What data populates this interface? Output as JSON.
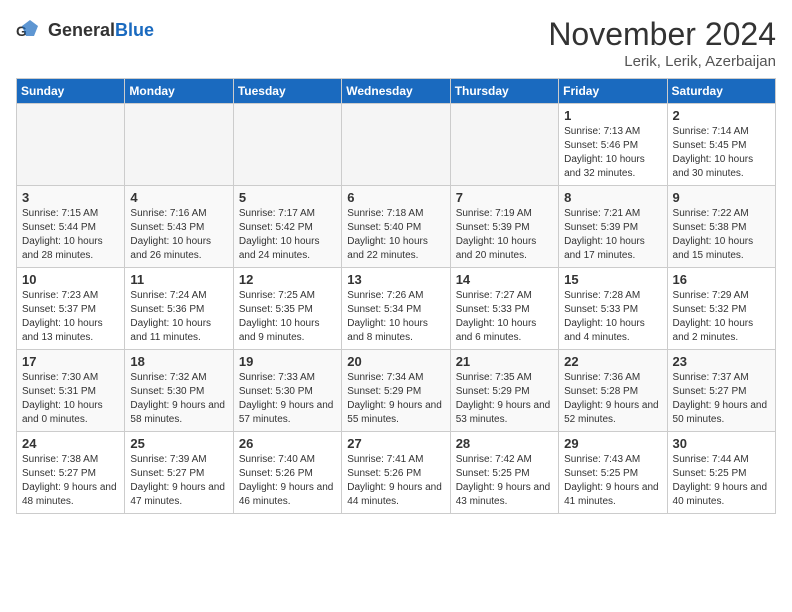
{
  "header": {
    "logo_general": "General",
    "logo_blue": "Blue",
    "month_title": "November 2024",
    "location": "Lerik, Lerik, Azerbaijan"
  },
  "columns": [
    "Sunday",
    "Monday",
    "Tuesday",
    "Wednesday",
    "Thursday",
    "Friday",
    "Saturday"
  ],
  "weeks": [
    [
      {
        "day": "",
        "info": ""
      },
      {
        "day": "",
        "info": ""
      },
      {
        "day": "",
        "info": ""
      },
      {
        "day": "",
        "info": ""
      },
      {
        "day": "",
        "info": ""
      },
      {
        "day": "1",
        "info": "Sunrise: 7:13 AM\nSunset: 5:46 PM\nDaylight: 10 hours and 32 minutes."
      },
      {
        "day": "2",
        "info": "Sunrise: 7:14 AM\nSunset: 5:45 PM\nDaylight: 10 hours and 30 minutes."
      }
    ],
    [
      {
        "day": "3",
        "info": "Sunrise: 7:15 AM\nSunset: 5:44 PM\nDaylight: 10 hours and 28 minutes."
      },
      {
        "day": "4",
        "info": "Sunrise: 7:16 AM\nSunset: 5:43 PM\nDaylight: 10 hours and 26 minutes."
      },
      {
        "day": "5",
        "info": "Sunrise: 7:17 AM\nSunset: 5:42 PM\nDaylight: 10 hours and 24 minutes."
      },
      {
        "day": "6",
        "info": "Sunrise: 7:18 AM\nSunset: 5:40 PM\nDaylight: 10 hours and 22 minutes."
      },
      {
        "day": "7",
        "info": "Sunrise: 7:19 AM\nSunset: 5:39 PM\nDaylight: 10 hours and 20 minutes."
      },
      {
        "day": "8",
        "info": "Sunrise: 7:21 AM\nSunset: 5:39 PM\nDaylight: 10 hours and 17 minutes."
      },
      {
        "day": "9",
        "info": "Sunrise: 7:22 AM\nSunset: 5:38 PM\nDaylight: 10 hours and 15 minutes."
      }
    ],
    [
      {
        "day": "10",
        "info": "Sunrise: 7:23 AM\nSunset: 5:37 PM\nDaylight: 10 hours and 13 minutes."
      },
      {
        "day": "11",
        "info": "Sunrise: 7:24 AM\nSunset: 5:36 PM\nDaylight: 10 hours and 11 minutes."
      },
      {
        "day": "12",
        "info": "Sunrise: 7:25 AM\nSunset: 5:35 PM\nDaylight: 10 hours and 9 minutes."
      },
      {
        "day": "13",
        "info": "Sunrise: 7:26 AM\nSunset: 5:34 PM\nDaylight: 10 hours and 8 minutes."
      },
      {
        "day": "14",
        "info": "Sunrise: 7:27 AM\nSunset: 5:33 PM\nDaylight: 10 hours and 6 minutes."
      },
      {
        "day": "15",
        "info": "Sunrise: 7:28 AM\nSunset: 5:33 PM\nDaylight: 10 hours and 4 minutes."
      },
      {
        "day": "16",
        "info": "Sunrise: 7:29 AM\nSunset: 5:32 PM\nDaylight: 10 hours and 2 minutes."
      }
    ],
    [
      {
        "day": "17",
        "info": "Sunrise: 7:30 AM\nSunset: 5:31 PM\nDaylight: 10 hours and 0 minutes."
      },
      {
        "day": "18",
        "info": "Sunrise: 7:32 AM\nSunset: 5:30 PM\nDaylight: 9 hours and 58 minutes."
      },
      {
        "day": "19",
        "info": "Sunrise: 7:33 AM\nSunset: 5:30 PM\nDaylight: 9 hours and 57 minutes."
      },
      {
        "day": "20",
        "info": "Sunrise: 7:34 AM\nSunset: 5:29 PM\nDaylight: 9 hours and 55 minutes."
      },
      {
        "day": "21",
        "info": "Sunrise: 7:35 AM\nSunset: 5:29 PM\nDaylight: 9 hours and 53 minutes."
      },
      {
        "day": "22",
        "info": "Sunrise: 7:36 AM\nSunset: 5:28 PM\nDaylight: 9 hours and 52 minutes."
      },
      {
        "day": "23",
        "info": "Sunrise: 7:37 AM\nSunset: 5:27 PM\nDaylight: 9 hours and 50 minutes."
      }
    ],
    [
      {
        "day": "24",
        "info": "Sunrise: 7:38 AM\nSunset: 5:27 PM\nDaylight: 9 hours and 48 minutes."
      },
      {
        "day": "25",
        "info": "Sunrise: 7:39 AM\nSunset: 5:27 PM\nDaylight: 9 hours and 47 minutes."
      },
      {
        "day": "26",
        "info": "Sunrise: 7:40 AM\nSunset: 5:26 PM\nDaylight: 9 hours and 46 minutes."
      },
      {
        "day": "27",
        "info": "Sunrise: 7:41 AM\nSunset: 5:26 PM\nDaylight: 9 hours and 44 minutes."
      },
      {
        "day": "28",
        "info": "Sunrise: 7:42 AM\nSunset: 5:25 PM\nDaylight: 9 hours and 43 minutes."
      },
      {
        "day": "29",
        "info": "Sunrise: 7:43 AM\nSunset: 5:25 PM\nDaylight: 9 hours and 41 minutes."
      },
      {
        "day": "30",
        "info": "Sunrise: 7:44 AM\nSunset: 5:25 PM\nDaylight: 9 hours and 40 minutes."
      }
    ]
  ]
}
